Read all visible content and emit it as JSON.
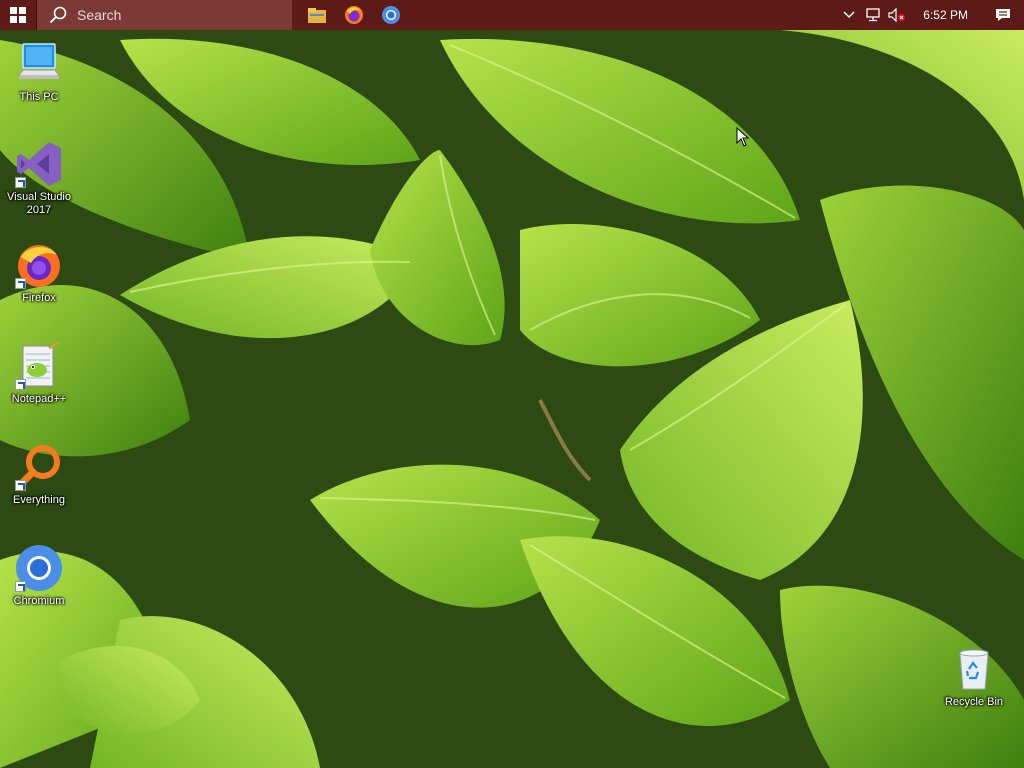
{
  "taskbar": {
    "search_placeholder": "Search",
    "pinned": [
      {
        "name": "file-explorer"
      },
      {
        "name": "firefox"
      },
      {
        "name": "chromium"
      }
    ],
    "clock": "6:52 PM",
    "colors": {
      "taskbar": "#5e1a16",
      "search": "#7c3a36"
    }
  },
  "desktop": {
    "icons": [
      {
        "label": "This PC",
        "icon": "computer-icon"
      },
      {
        "label": "Visual Studio 2017",
        "icon": "visual-studio-icon"
      },
      {
        "label": "Firefox",
        "icon": "firefox-icon"
      },
      {
        "label": "Notepad++",
        "icon": "notepadpp-icon"
      },
      {
        "label": "Everything",
        "icon": "everything-search-icon"
      },
      {
        "label": "Chromium",
        "icon": "chromium-icon"
      },
      {
        "label": "Recycle Bin",
        "icon": "recycle-bin-icon"
      }
    ]
  }
}
